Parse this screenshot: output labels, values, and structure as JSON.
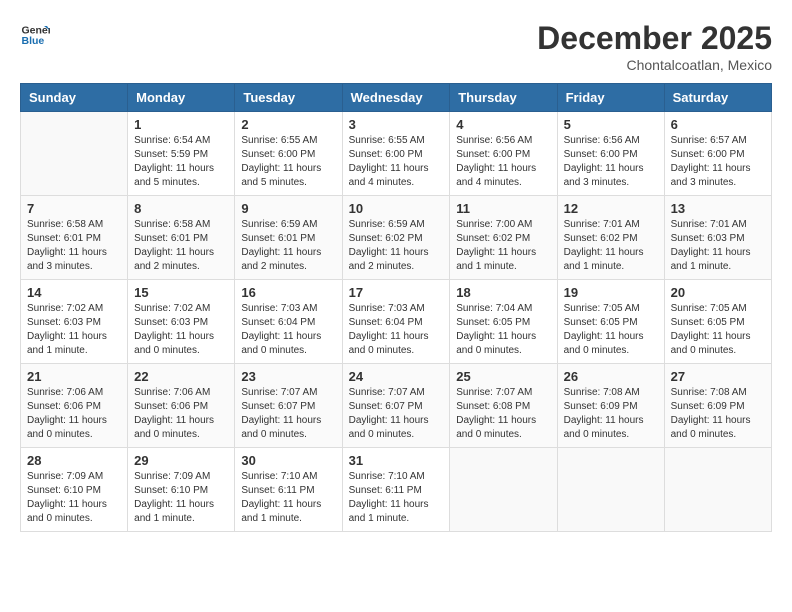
{
  "header": {
    "logo_line1": "General",
    "logo_line2": "Blue",
    "month": "December 2025",
    "location": "Chontalcoatlan, Mexico"
  },
  "weekdays": [
    "Sunday",
    "Monday",
    "Tuesday",
    "Wednesday",
    "Thursday",
    "Friday",
    "Saturday"
  ],
  "weeks": [
    [
      {
        "day": "",
        "info": ""
      },
      {
        "day": "1",
        "info": "Sunrise: 6:54 AM\nSunset: 5:59 PM\nDaylight: 11 hours\nand 5 minutes."
      },
      {
        "day": "2",
        "info": "Sunrise: 6:55 AM\nSunset: 6:00 PM\nDaylight: 11 hours\nand 5 minutes."
      },
      {
        "day": "3",
        "info": "Sunrise: 6:55 AM\nSunset: 6:00 PM\nDaylight: 11 hours\nand 4 minutes."
      },
      {
        "day": "4",
        "info": "Sunrise: 6:56 AM\nSunset: 6:00 PM\nDaylight: 11 hours\nand 4 minutes."
      },
      {
        "day": "5",
        "info": "Sunrise: 6:56 AM\nSunset: 6:00 PM\nDaylight: 11 hours\nand 3 minutes."
      },
      {
        "day": "6",
        "info": "Sunrise: 6:57 AM\nSunset: 6:00 PM\nDaylight: 11 hours\nand 3 minutes."
      }
    ],
    [
      {
        "day": "7",
        "info": "Sunrise: 6:58 AM\nSunset: 6:01 PM\nDaylight: 11 hours\nand 3 minutes."
      },
      {
        "day": "8",
        "info": "Sunrise: 6:58 AM\nSunset: 6:01 PM\nDaylight: 11 hours\nand 2 minutes."
      },
      {
        "day": "9",
        "info": "Sunrise: 6:59 AM\nSunset: 6:01 PM\nDaylight: 11 hours\nand 2 minutes."
      },
      {
        "day": "10",
        "info": "Sunrise: 6:59 AM\nSunset: 6:02 PM\nDaylight: 11 hours\nand 2 minutes."
      },
      {
        "day": "11",
        "info": "Sunrise: 7:00 AM\nSunset: 6:02 PM\nDaylight: 11 hours\nand 1 minute."
      },
      {
        "day": "12",
        "info": "Sunrise: 7:01 AM\nSunset: 6:02 PM\nDaylight: 11 hours\nand 1 minute."
      },
      {
        "day": "13",
        "info": "Sunrise: 7:01 AM\nSunset: 6:03 PM\nDaylight: 11 hours\nand 1 minute."
      }
    ],
    [
      {
        "day": "14",
        "info": "Sunrise: 7:02 AM\nSunset: 6:03 PM\nDaylight: 11 hours\nand 1 minute."
      },
      {
        "day": "15",
        "info": "Sunrise: 7:02 AM\nSunset: 6:03 PM\nDaylight: 11 hours\nand 0 minutes."
      },
      {
        "day": "16",
        "info": "Sunrise: 7:03 AM\nSunset: 6:04 PM\nDaylight: 11 hours\nand 0 minutes."
      },
      {
        "day": "17",
        "info": "Sunrise: 7:03 AM\nSunset: 6:04 PM\nDaylight: 11 hours\nand 0 minutes."
      },
      {
        "day": "18",
        "info": "Sunrise: 7:04 AM\nSunset: 6:05 PM\nDaylight: 11 hours\nand 0 minutes."
      },
      {
        "day": "19",
        "info": "Sunrise: 7:05 AM\nSunset: 6:05 PM\nDaylight: 11 hours\nand 0 minutes."
      },
      {
        "day": "20",
        "info": "Sunrise: 7:05 AM\nSunset: 6:05 PM\nDaylight: 11 hours\nand 0 minutes."
      }
    ],
    [
      {
        "day": "21",
        "info": "Sunrise: 7:06 AM\nSunset: 6:06 PM\nDaylight: 11 hours\nand 0 minutes."
      },
      {
        "day": "22",
        "info": "Sunrise: 7:06 AM\nSunset: 6:06 PM\nDaylight: 11 hours\nand 0 minutes."
      },
      {
        "day": "23",
        "info": "Sunrise: 7:07 AM\nSunset: 6:07 PM\nDaylight: 11 hours\nand 0 minutes."
      },
      {
        "day": "24",
        "info": "Sunrise: 7:07 AM\nSunset: 6:07 PM\nDaylight: 11 hours\nand 0 minutes."
      },
      {
        "day": "25",
        "info": "Sunrise: 7:07 AM\nSunset: 6:08 PM\nDaylight: 11 hours\nand 0 minutes."
      },
      {
        "day": "26",
        "info": "Sunrise: 7:08 AM\nSunset: 6:09 PM\nDaylight: 11 hours\nand 0 minutes."
      },
      {
        "day": "27",
        "info": "Sunrise: 7:08 AM\nSunset: 6:09 PM\nDaylight: 11 hours\nand 0 minutes."
      }
    ],
    [
      {
        "day": "28",
        "info": "Sunrise: 7:09 AM\nSunset: 6:10 PM\nDaylight: 11 hours\nand 0 minutes."
      },
      {
        "day": "29",
        "info": "Sunrise: 7:09 AM\nSunset: 6:10 PM\nDaylight: 11 hours\nand 1 minute."
      },
      {
        "day": "30",
        "info": "Sunrise: 7:10 AM\nSunset: 6:11 PM\nDaylight: 11 hours\nand 1 minute."
      },
      {
        "day": "31",
        "info": "Sunrise: 7:10 AM\nSunset: 6:11 PM\nDaylight: 11 hours\nand 1 minute."
      },
      {
        "day": "",
        "info": ""
      },
      {
        "day": "",
        "info": ""
      },
      {
        "day": "",
        "info": ""
      }
    ]
  ]
}
